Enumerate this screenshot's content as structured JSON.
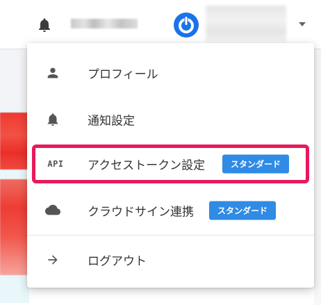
{
  "header": {
    "icons": {
      "notifications": "bell-icon",
      "account_logo": "power-logo-icon",
      "menu_toggle": "chevron-down-icon"
    }
  },
  "colors": {
    "accent_badge": "#2f8be6",
    "highlight_border": "#e8195a",
    "logo": "#1a73e8"
  },
  "menu": {
    "items": [
      {
        "icon": "person-icon",
        "label": "プロフィール"
      },
      {
        "icon": "bell-icon",
        "label": "通知設定"
      },
      {
        "icon": "api-icon",
        "icon_text": "API",
        "label": "アクセストークン設定",
        "badge": "スタンダード"
      },
      {
        "icon": "cloud-icon",
        "label": "クラウドサイン連携",
        "badge": "スタンダード"
      },
      {
        "icon": "arrow-right-icon",
        "label": "ログアウト"
      }
    ]
  }
}
